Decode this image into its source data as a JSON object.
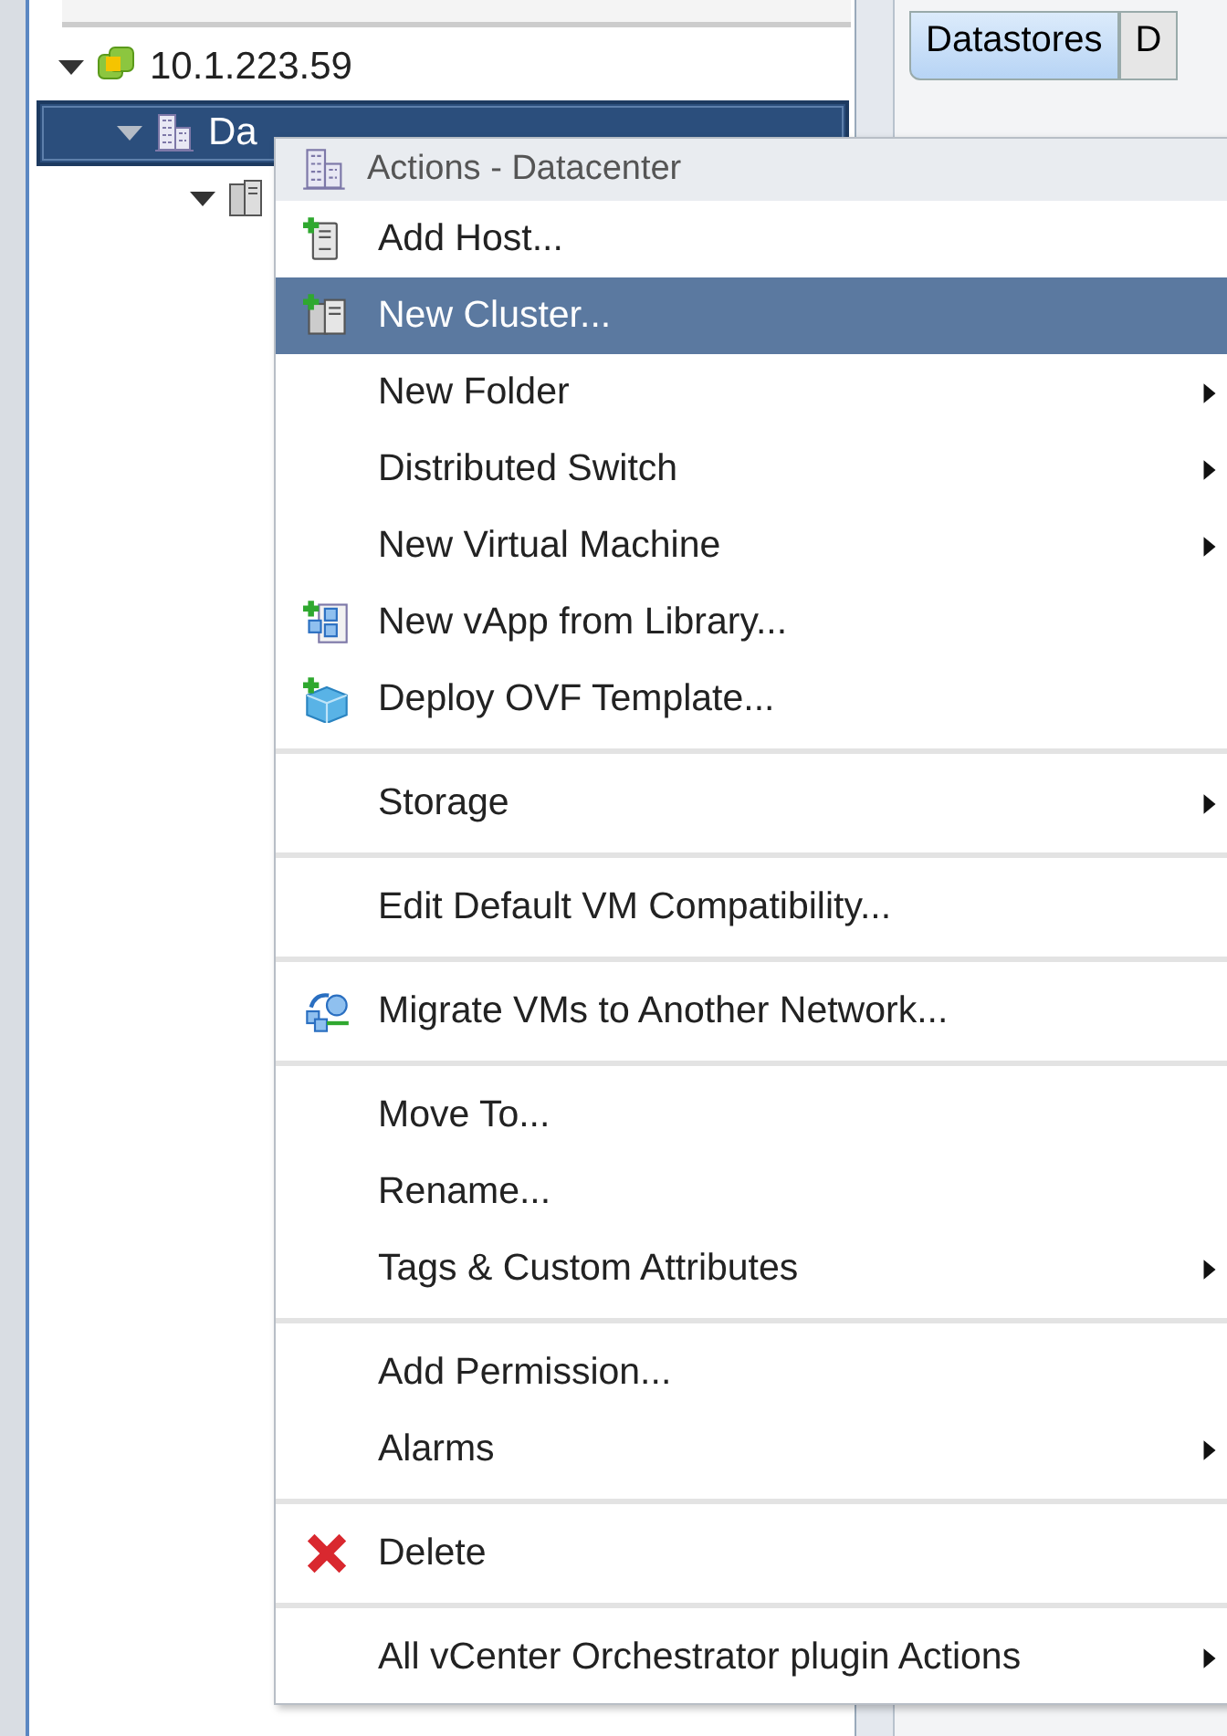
{
  "tree": [
    {
      "label": "10.1.223.59",
      "kind": "vcenter",
      "expanded": true,
      "selected": false
    },
    {
      "label": "Da",
      "kind": "datacenter",
      "expanded": true,
      "selected": true
    },
    {
      "kind": "cluster",
      "expanded": true,
      "selected": false
    }
  ],
  "tabs": [
    {
      "label": "Datastores",
      "selected": true
    },
    {
      "label": "D",
      "selected": false
    }
  ],
  "menu": {
    "title": "Actions - Datacenter",
    "items": [
      {
        "label": "Add Host...",
        "kind": "add-host",
        "submenu": false,
        "selected": false,
        "separator_before": false
      },
      {
        "label": "New Cluster...",
        "kind": "add-cluster",
        "submenu": false,
        "selected": true,
        "separator_before": false
      },
      {
        "label": "New Folder",
        "kind": "plain",
        "submenu": true,
        "selected": false,
        "separator_before": false
      },
      {
        "label": "Distributed Switch",
        "kind": "plain",
        "submenu": true,
        "selected": false,
        "separator_before": false
      },
      {
        "label": "New Virtual Machine",
        "kind": "plain",
        "submenu": true,
        "selected": false,
        "separator_before": false
      },
      {
        "label": "New vApp from Library...",
        "kind": "vapp",
        "submenu": false,
        "selected": false,
        "separator_before": false
      },
      {
        "label": "Deploy OVF Template...",
        "kind": "ovf",
        "submenu": false,
        "selected": false,
        "separator_before": false
      },
      {
        "label": "Storage",
        "kind": "plain",
        "submenu": true,
        "selected": false,
        "separator_before": true
      },
      {
        "label": "Edit Default VM Compatibility...",
        "kind": "plain",
        "submenu": false,
        "selected": false,
        "separator_before": true
      },
      {
        "label": "Migrate VMs to Another Network...",
        "kind": "migrate",
        "submenu": false,
        "selected": false,
        "separator_before": true
      },
      {
        "label": "Move To...",
        "kind": "plain",
        "submenu": false,
        "selected": false,
        "separator_before": true
      },
      {
        "label": "Rename...",
        "kind": "plain",
        "submenu": false,
        "selected": false,
        "separator_before": false
      },
      {
        "label": "Tags & Custom Attributes",
        "kind": "plain",
        "submenu": true,
        "selected": false,
        "separator_before": false
      },
      {
        "label": "Add Permission...",
        "kind": "plain",
        "submenu": false,
        "selected": false,
        "separator_before": true
      },
      {
        "label": "Alarms",
        "kind": "plain",
        "submenu": true,
        "selected": false,
        "separator_before": false
      },
      {
        "label": "Delete",
        "kind": "delete",
        "submenu": false,
        "selected": false,
        "separator_before": true
      },
      {
        "label": "All vCenter Orchestrator plugin Actions",
        "kind": "plain",
        "submenu": true,
        "selected": false,
        "separator_before": true
      }
    ]
  }
}
